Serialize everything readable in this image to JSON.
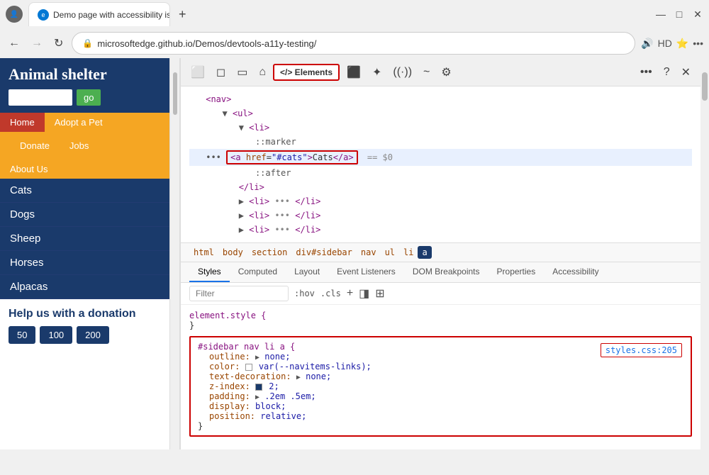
{
  "browser": {
    "tab_title": "Demo page with accessibility iss",
    "tab_favicon": "E",
    "url": "microsoftedge.github.io/Demos/devtools-a11y-testing/",
    "new_tab_icon": "+",
    "back_icon": "←",
    "forward_icon": "→",
    "refresh_icon": "↻",
    "security_icon": "🔒"
  },
  "window_controls": {
    "minimize": "—",
    "maximize": "□",
    "close": "✕"
  },
  "webpage": {
    "title": "Animal shelter",
    "search_placeholder": "",
    "go_label": "go",
    "nav": [
      {
        "label": "Home",
        "type": "home"
      },
      {
        "label": "Adopt a Pet",
        "type": "adopt"
      },
      {
        "label": "Donate",
        "type": "yellow"
      },
      {
        "label": "Jobs",
        "type": "yellow"
      },
      {
        "label": "About Us",
        "type": "yellow"
      }
    ],
    "sidebar_items": [
      "Cats",
      "Dogs",
      "Sheep",
      "Horses",
      "Alpacas"
    ],
    "donation_title": "Help us with a donation",
    "donation_amounts": [
      "50",
      "100",
      "200"
    ]
  },
  "devtools": {
    "toolbar_icons": [
      "inspect",
      "select",
      "responsive",
      "home",
      "elements",
      "emulate",
      "device",
      "wifi",
      "performance",
      "settings",
      "more",
      "help",
      "close"
    ],
    "elements_label": "</> Elements",
    "dom": {
      "nav_tag": "<nav>",
      "ul_tag": "<ul>",
      "li_tag": "<li>",
      "marker": "::marker",
      "highlighted": "<a href=\"#cats\">Cats</a>",
      "eq_sign": "== $0",
      "after": "::after",
      "li_close": "</li>",
      "more_li": [
        "▶ <li> ••• </li>",
        "▶ <li> ••• </li>",
        "▶ <li> ••• </li>"
      ]
    },
    "breadcrumbs": [
      "html",
      "body",
      "section",
      "div#sidebar",
      "nav",
      "ul",
      "li",
      "a"
    ],
    "tabs": [
      "Styles",
      "Computed",
      "Layout",
      "Event Listeners",
      "DOM Breakpoints",
      "Properties",
      "Accessibility"
    ],
    "active_tab": "Styles",
    "filter_placeholder": "Filter",
    "filter_pseudo": ":hov",
    "filter_cls": ".cls",
    "styles": {
      "element_style": {
        "selector": "element.style {",
        "close": "}"
      },
      "sidebar_rule": {
        "selector": "#sidebar nav li a {",
        "close": "}",
        "link": "styles.css:205",
        "properties": [
          {
            "prop": "outline:",
            "val": "▶ none;"
          },
          {
            "prop": "color:",
            "val": "□ var(--navitems-links);"
          },
          {
            "prop": "text-decoration:",
            "val": "▶ none;"
          },
          {
            "prop": "z-index:",
            "val": "■ 2;"
          },
          {
            "prop": "padding:",
            "val": "▶ .2em .5em;"
          },
          {
            "prop": "display:",
            "val": "block;"
          },
          {
            "prop": "position:",
            "val": "relative;"
          }
        ]
      }
    }
  }
}
